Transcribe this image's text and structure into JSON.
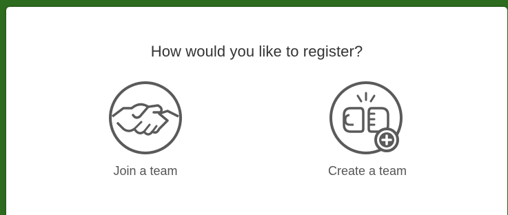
{
  "dialog": {
    "title": "How would you like to register?",
    "options": [
      {
        "label": "Join a team",
        "icon": "handshake-icon"
      },
      {
        "label": "Create a team",
        "icon": "fist-bump-add-icon"
      }
    ]
  },
  "colors": {
    "background": "#2d6b1e",
    "panel": "#ffffff",
    "icon_stroke": "#5a5a5a",
    "text": "#333333"
  }
}
